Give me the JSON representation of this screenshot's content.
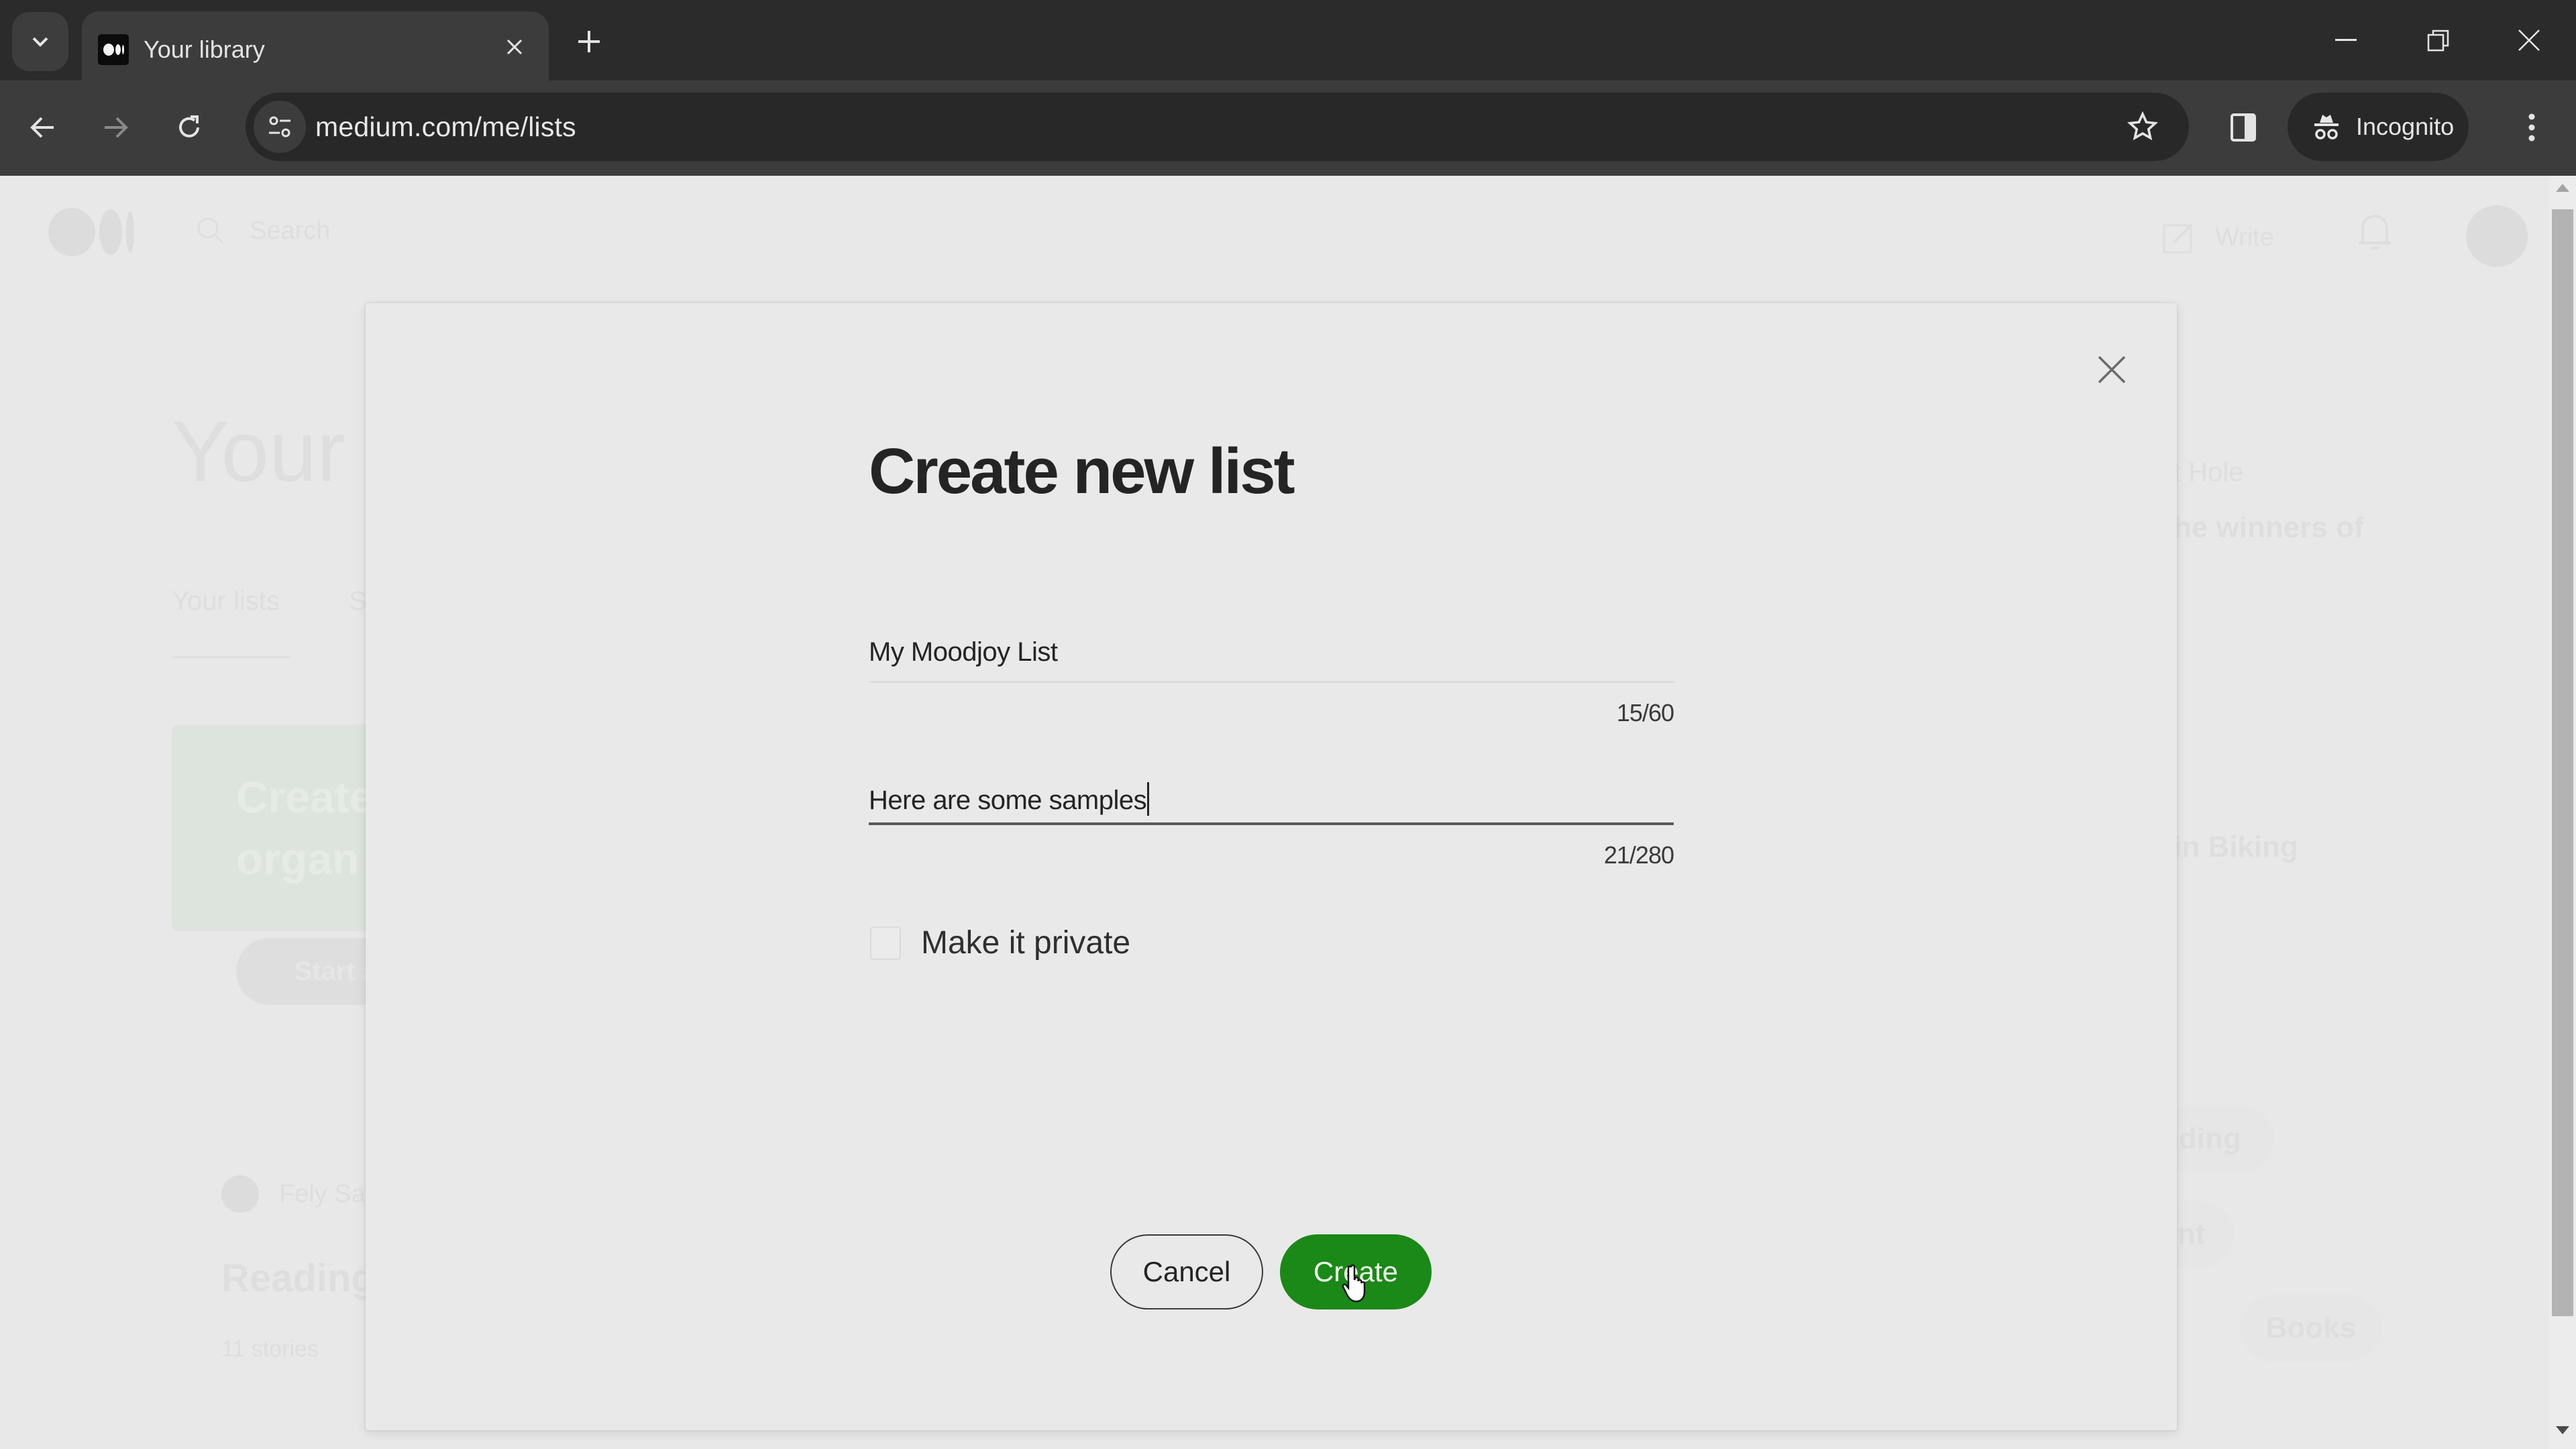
{
  "browser": {
    "tab": {
      "title": "Your library",
      "favicon": "medium-logo-icon"
    },
    "url": "medium.com/me/lists",
    "incognito_label": "Incognito",
    "icons": {
      "tab_search": "chevron-down-icon",
      "tab_close": "close-icon",
      "new_tab": "plus-icon",
      "minimize": "minimize-icon",
      "restore": "restore-icon",
      "close_window": "close-icon",
      "back": "arrow-left-icon",
      "forward": "arrow-right-icon",
      "reload": "reload-icon",
      "site_info": "tune-icon",
      "bookmark": "star-icon",
      "side_panel": "side-panel-icon",
      "incognito": "incognito-icon",
      "menu": "kebab-menu-icon"
    }
  },
  "background_page": {
    "search_placeholder": "Search",
    "write_label": "Write",
    "heading": "Your library",
    "heading_visible": "Your l",
    "tabs": [
      "Your lists",
      "S"
    ],
    "promo_card": {
      "text_line1": "Create",
      "text_line2": "organ",
      "button": "Start a l"
    },
    "list_card": {
      "author": "Fely Sa",
      "title": "Reading",
      "meta": "11 stories"
    },
    "right_column": {
      "line1": "t Hole",
      "line2": "he winners of",
      "line3": "in Biking",
      "topics": [
        "Coding",
        "ment",
        "Books"
      ]
    }
  },
  "modal": {
    "title": "Create new list",
    "name_field": {
      "value": "My Moodjoy List",
      "counter": "15/60"
    },
    "description_field": {
      "value": "Here are some samples",
      "counter": "21/280"
    },
    "private_checkbox": {
      "label": "Make it private",
      "checked": false
    },
    "cancel_label": "Cancel",
    "create_label": "Create",
    "accent_color": "#1a8917"
  }
}
